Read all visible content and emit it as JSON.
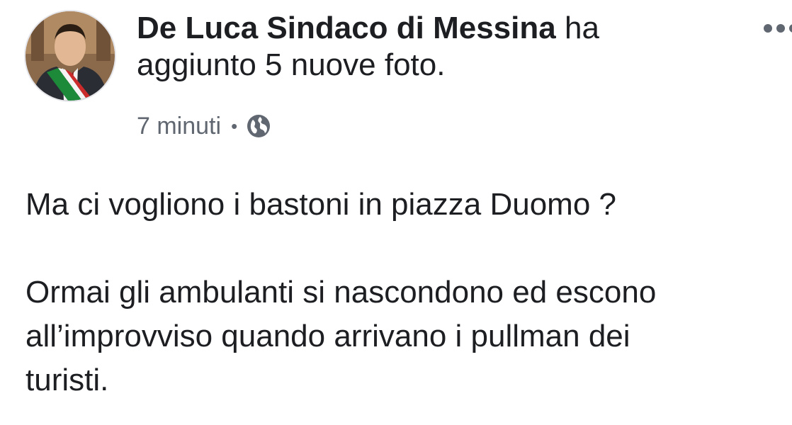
{
  "post": {
    "author": "De Luca Sindaco di Messina",
    "action_text": "ha aggiunto 5 nuove foto.",
    "timestamp": "7 minuti",
    "separator": "•",
    "privacy_icon": "globe-icon",
    "more_icon": "more-options-icon",
    "avatar_icon": "profile-photo",
    "body": {
      "paragraph1": "Ma ci vogliono i bastoni in piazza Duomo ?",
      "paragraph2_line1": "Ormai gli ambulanti si nascondono ed escono",
      "paragraph2_line2": "all’improvviso quando arrivano i pullman dei",
      "paragraph2_line3": "turisti."
    }
  },
  "colors": {
    "text": "#1c1e21",
    "secondary_text": "#606770",
    "background": "#ffffff"
  }
}
